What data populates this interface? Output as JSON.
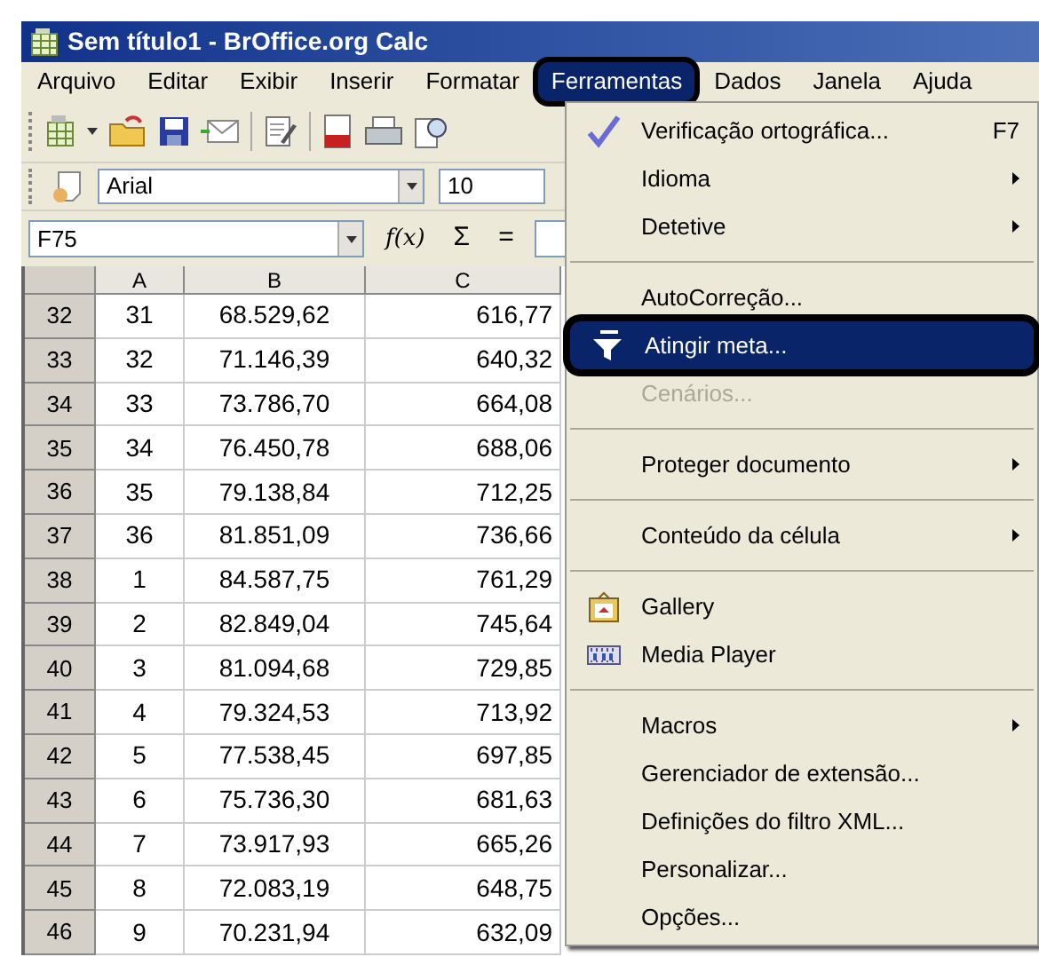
{
  "window": {
    "title": "Sem título1 - BrOffice.org Calc"
  },
  "menu_bar": [
    {
      "label": "Arquivo",
      "selected": false
    },
    {
      "label": "Editar",
      "selected": false
    },
    {
      "label": "Exibir",
      "selected": false
    },
    {
      "label": "Inserir",
      "selected": false
    },
    {
      "label": "Formatar",
      "selected": false
    },
    {
      "label": "Ferramentas",
      "selected": true
    },
    {
      "label": "Dados",
      "selected": false
    },
    {
      "label": "Janela",
      "selected": false
    },
    {
      "label": "Ajuda",
      "selected": false
    }
  ],
  "formatting_toolbar": {
    "font_name": "Arial",
    "font_size": "10"
  },
  "formula_bar": {
    "name_box": "F75",
    "function_wizard": "f(x)",
    "sum": "Σ",
    "equals": "="
  },
  "sheet": {
    "columns": [
      "A",
      "B",
      "C"
    ],
    "rows": [
      {
        "header": "32",
        "cells": [
          "31",
          "68.529,62",
          "616,77"
        ]
      },
      {
        "header": "33",
        "cells": [
          "32",
          "71.146,39",
          "640,32"
        ]
      },
      {
        "header": "34",
        "cells": [
          "33",
          "73.786,70",
          "664,08"
        ]
      },
      {
        "header": "35",
        "cells": [
          "34",
          "76.450,78",
          "688,06"
        ]
      },
      {
        "header": "36",
        "cells": [
          "35",
          "79.138,84",
          "712,25"
        ]
      },
      {
        "header": "37",
        "cells": [
          "36",
          "81.851,09",
          "736,66"
        ]
      },
      {
        "header": "38",
        "cells": [
          "1",
          "84.587,75",
          "761,29"
        ]
      },
      {
        "header": "39",
        "cells": [
          "2",
          "82.849,04",
          "745,64"
        ]
      },
      {
        "header": "40",
        "cells": [
          "3",
          "81.094,68",
          "729,85"
        ]
      },
      {
        "header": "41",
        "cells": [
          "4",
          "79.324,53",
          "713,92"
        ]
      },
      {
        "header": "42",
        "cells": [
          "5",
          "77.538,45",
          "697,85"
        ]
      },
      {
        "header": "43",
        "cells": [
          "6",
          "75.736,30",
          "681,63"
        ]
      },
      {
        "header": "44",
        "cells": [
          "7",
          "73.917,93",
          "665,26"
        ]
      },
      {
        "header": "45",
        "cells": [
          "8",
          "72.083,19",
          "648,75"
        ]
      },
      {
        "header": "46",
        "cells": [
          "9",
          "70.231,94",
          "632,09"
        ]
      }
    ]
  },
  "tools_menu": [
    {
      "kind": "item",
      "label": "Verificação ortográfica...",
      "shortcut": "F7",
      "submenu": false,
      "disabled": false,
      "selected": false
    },
    {
      "kind": "item",
      "label": "Idioma",
      "submenu": true,
      "disabled": false,
      "selected": false
    },
    {
      "kind": "item",
      "label": "Detetive",
      "submenu": true,
      "disabled": false,
      "selected": false
    },
    {
      "kind": "separator"
    },
    {
      "kind": "item",
      "label": "AutoCorreção...",
      "submenu": false,
      "disabled": false,
      "selected": false
    },
    {
      "kind": "item",
      "label": "Atingir meta...",
      "submenu": false,
      "disabled": false,
      "selected": true
    },
    {
      "kind": "item",
      "label": "Cenários...",
      "submenu": false,
      "disabled": true,
      "selected": false
    },
    {
      "kind": "separator"
    },
    {
      "kind": "item",
      "label": "Proteger documento",
      "submenu": true,
      "disabled": false,
      "selected": false
    },
    {
      "kind": "separator"
    },
    {
      "kind": "item",
      "label": "Conteúdo da célula",
      "submenu": true,
      "disabled": false,
      "selected": false
    },
    {
      "kind": "separator"
    },
    {
      "kind": "item",
      "label": "Gallery",
      "submenu": false,
      "disabled": false,
      "selected": false
    },
    {
      "kind": "item",
      "label": "Media Player",
      "submenu": false,
      "disabled": false,
      "selected": false
    },
    {
      "kind": "separator"
    },
    {
      "kind": "item",
      "label": "Macros",
      "submenu": true,
      "disabled": false,
      "selected": false
    },
    {
      "kind": "item",
      "label": "Gerenciador de extensão...",
      "submenu": false,
      "disabled": false,
      "selected": false
    },
    {
      "kind": "item",
      "label": "Definições do filtro XML...",
      "submenu": false,
      "disabled": false,
      "selected": false
    },
    {
      "kind": "item",
      "label": "Personalizar...",
      "submenu": false,
      "disabled": false,
      "selected": false
    },
    {
      "kind": "item",
      "label": "Opções...",
      "submenu": false,
      "disabled": false,
      "selected": false
    }
  ]
}
